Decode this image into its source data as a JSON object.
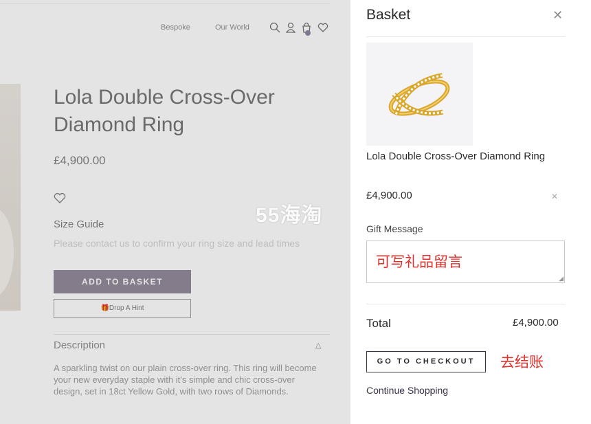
{
  "nav": {
    "items": [
      "Bespoke",
      "Our World"
    ],
    "icons": [
      "search-icon",
      "account-icon",
      "bag-icon",
      "wishlist-icon"
    ]
  },
  "product": {
    "title": "Lola Double Cross-Over Diamond Ring",
    "price": "£4,900.00",
    "size_guide": "Size Guide",
    "size_note": "Please contact us to confirm your ring size and lead times",
    "add_to_basket": "ADD TO BASKET",
    "drop_hint": "Drop A Hint",
    "description_heading": "Description",
    "description_text": "A sparkling twist on our plain cross-over ring. This ring will become your new everyday staple with it’s simple and chic cross-over design, set in 18ct Yellow Gold, with two rows of Diamonds."
  },
  "watermark": "55海淘",
  "basket": {
    "title": "Basket",
    "item": {
      "name": "Lola Double Cross-Over Diamond Ring",
      "price": "£4,900.00"
    },
    "gift_message_label": "Gift Message",
    "gift_message_annotation": "可写礼品留言",
    "total_label": "Total",
    "total_value": "£4,900.00",
    "checkout_label": "GO TO CHECKOUT",
    "checkout_annotation": "去结账",
    "continue_label": "Continue Shopping"
  },
  "colors": {
    "brand_purple": "#8d8295",
    "dark_purple": "#3b3149",
    "annotation_red": "#e0312b",
    "gold": "#e6b83a"
  }
}
